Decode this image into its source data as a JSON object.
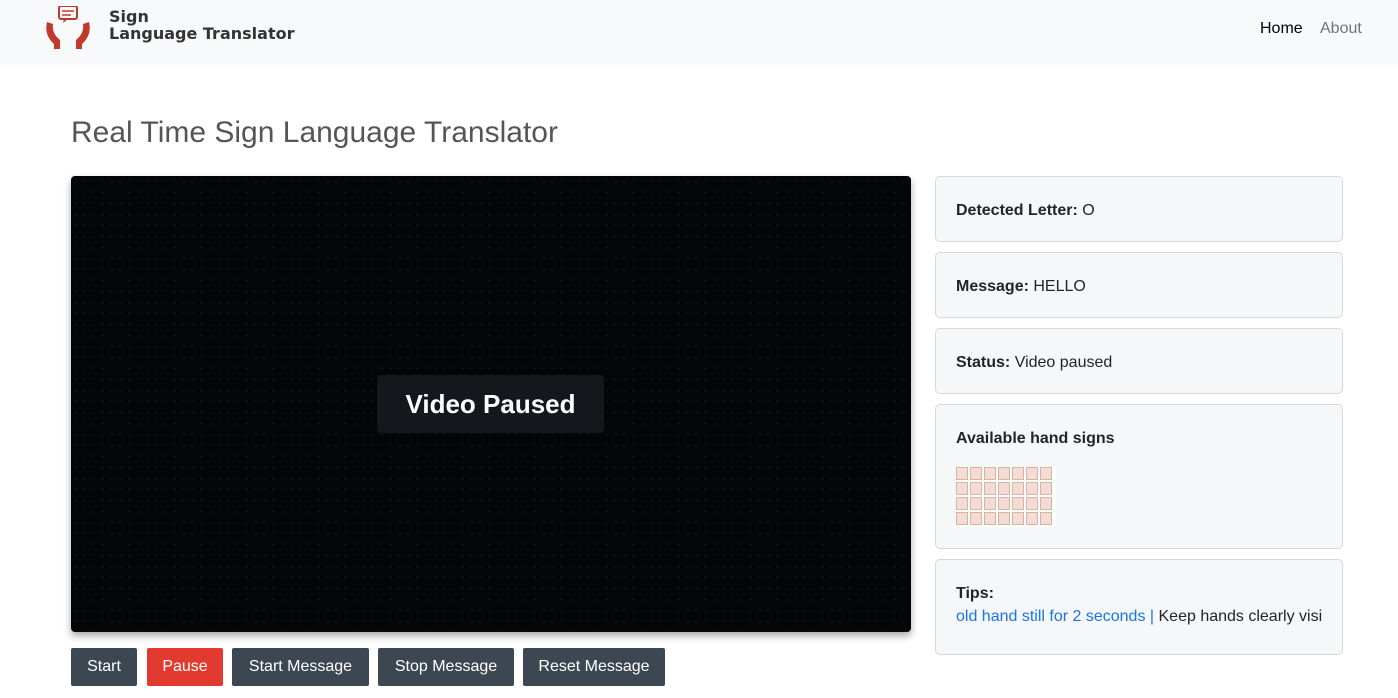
{
  "nav": {
    "brand_line1": "Sign",
    "brand_line2": "Language Translator",
    "home": "Home",
    "about": "About"
  },
  "page": {
    "title": "Real Time Sign Language Translator"
  },
  "video": {
    "overlay_text": "Video Paused"
  },
  "buttons": {
    "start": "Start",
    "pause": "Pause",
    "start_message": "Start Message",
    "stop_message": "Stop Message",
    "reset_message": "Reset Message"
  },
  "panel": {
    "detected_label": "Detected Letter:",
    "detected_value": "O",
    "message_label": "Message:",
    "message_value": "HELLO",
    "status_label": "Status:",
    "status_value": "Video paused",
    "signs_title": "Available hand signs",
    "tips_label": "Tips:",
    "tip_visible_1": "old hand still for 2 seconds |",
    "tip_visible_2": "Keep hands clearly visible"
  },
  "colors": {
    "accent_red": "#e23a2e",
    "button_dark": "#3d4752",
    "tip_blue": "#1a73e8"
  }
}
